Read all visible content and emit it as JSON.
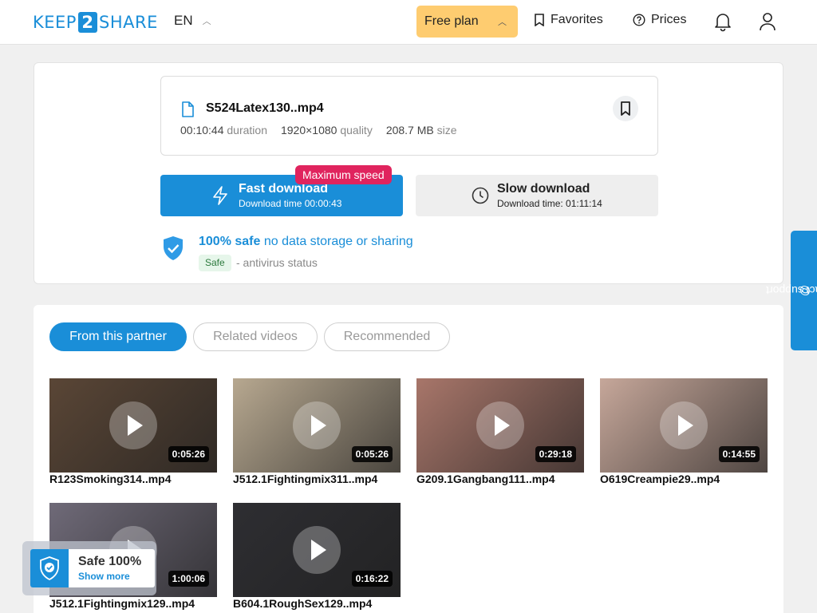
{
  "header": {
    "logo_left": "KEEP",
    "logo_mid": "2",
    "logo_right": "SHARE",
    "lang": "EN",
    "plan": "Free plan",
    "favorites": "Favorites",
    "prices": "Prices"
  },
  "file": {
    "name": "S524Latex130..mp4",
    "duration_value": "00:10:44",
    "duration_label": "duration",
    "quality_value": "1920×1080",
    "quality_label": "quality",
    "size_value": "208.7 MB",
    "size_label": "size"
  },
  "download": {
    "fast_title": "Fast download",
    "fast_sub": "Download time 00:00:43",
    "badge": "Maximum speed",
    "slow_title": "Slow download",
    "slow_sub": "Download time: 01:11:14"
  },
  "safety": {
    "bold": "100% safe",
    "rest": "no data storage or sharing",
    "pill": "Safe",
    "status": "- antivirus status"
  },
  "tabs": [
    "From this partner",
    "Related videos",
    "Recommended"
  ],
  "videos": [
    {
      "name": "R123Smoking314..mp4",
      "duration": "0:05:26",
      "color": "#5a4636"
    },
    {
      "name": "J512.1Fightingmix311..mp4",
      "duration": "0:05:26",
      "color": "#b7a890"
    },
    {
      "name": "G209.1Gangbang111..mp4",
      "duration": "0:29:18",
      "color": "#a8766a"
    },
    {
      "name": "O619Creampie29..mp4",
      "duration": "0:14:55",
      "color": "#c6a79a"
    },
    {
      "name": "J512.1Fightingmix129..mp4",
      "duration": "1:00:06",
      "color": "#6f6a78"
    },
    {
      "name": "B604.1RoughSex129..mp4",
      "duration": "0:16:22",
      "color": "#2e2e32"
    }
  ],
  "support": "contact support",
  "safe_widget": {
    "title": "Safe 100%",
    "link": "Show more"
  }
}
